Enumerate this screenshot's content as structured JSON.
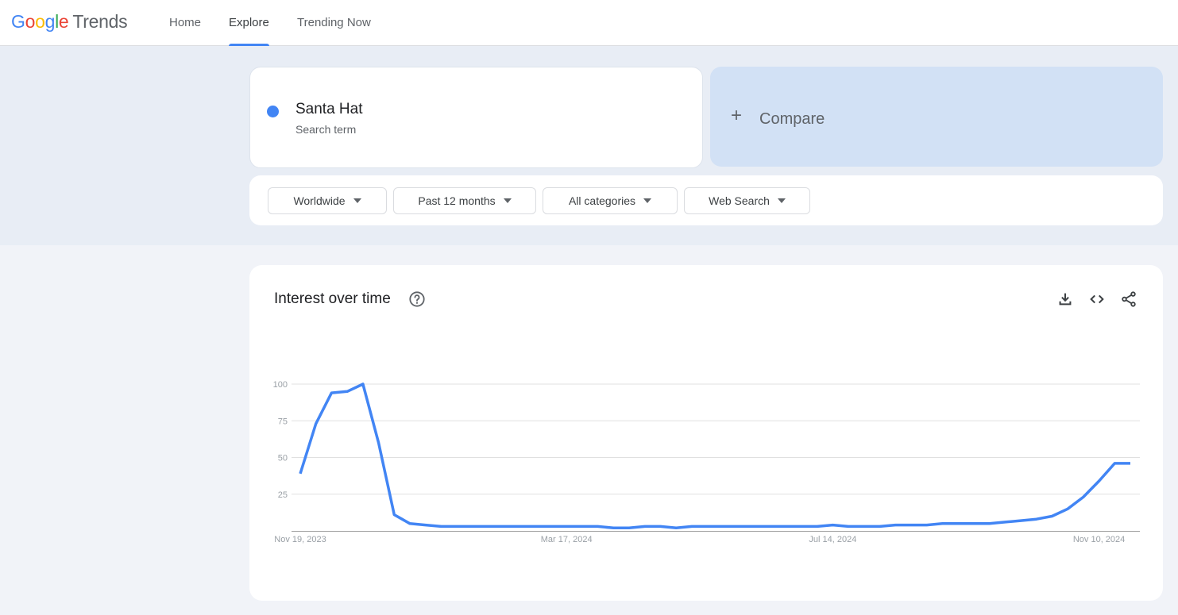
{
  "header": {
    "logo_google": [
      "G",
      "o",
      "o",
      "g",
      "l",
      "e"
    ],
    "logo_product": "Trends",
    "nav": [
      {
        "label": "Home",
        "active": false
      },
      {
        "label": "Explore",
        "active": true
      },
      {
        "label": "Trending Now",
        "active": false
      }
    ]
  },
  "search": {
    "term": "Santa Hat",
    "term_type": "Search term",
    "term_color": "#4285f4",
    "compare_label": "Compare"
  },
  "filters": {
    "region": "Worldwide",
    "time_range": "Past 12 months",
    "category": "All categories",
    "property": "Web Search"
  },
  "chart_section": {
    "title": "Interest over time",
    "actions": [
      "download-icon",
      "embed-code-icon",
      "share-icon"
    ]
  },
  "chart_data": {
    "type": "line",
    "title": "Interest over time",
    "xlabel": "",
    "ylabel": "",
    "ylim": [
      0,
      100
    ],
    "yticks": [
      25,
      50,
      75,
      100
    ],
    "grid": true,
    "x_tick_labels": [
      {
        "label": "Nov 19, 2023",
        "index": 0
      },
      {
        "label": "Mar 17, 2024",
        "index": 17
      },
      {
        "label": "Jul 14, 2024",
        "index": 34
      },
      {
        "label": "Nov 10, 2024",
        "index": 51
      }
    ],
    "series": [
      {
        "name": "Santa Hat",
        "color": "#4285f4",
        "values": [
          39,
          73,
          94,
          95,
          100,
          60,
          11,
          5,
          4,
          3,
          3,
          3,
          3,
          3,
          3,
          3,
          3,
          3,
          3,
          3,
          2,
          2,
          3,
          3,
          2,
          3,
          3,
          3,
          3,
          3,
          3,
          3,
          3,
          3,
          4,
          3,
          3,
          3,
          4,
          4,
          4,
          5,
          5,
          5,
          5,
          6,
          7,
          8,
          10,
          15,
          23,
          34,
          46,
          46
        ]
      }
    ]
  }
}
